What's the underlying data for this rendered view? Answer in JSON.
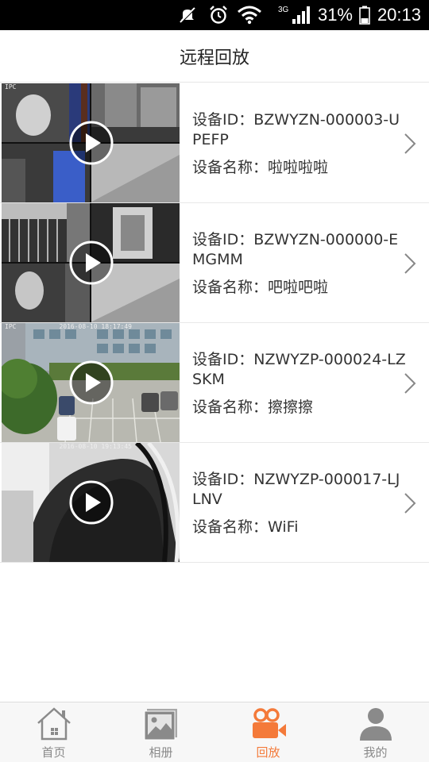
{
  "status_bar": {
    "network": "3G",
    "battery": "31%",
    "time": "20:13"
  },
  "header": {
    "title": "远程回放"
  },
  "devices": [
    {
      "id_text": "设备ID：BZWYZN-000003-UPEFP",
      "name_text": "设备名称：啦啦啦啦",
      "stamp_label": "IPC",
      "stamp_time": ""
    },
    {
      "id_text": "设备ID：BZWYZN-000000-EMGMM",
      "name_text": "设备名称：吧啦吧啦",
      "stamp_label": "",
      "stamp_time": ""
    },
    {
      "id_text": "设备ID：NZWYZP-000024-LZSKM",
      "name_text": "设备名称：擦擦擦",
      "stamp_label": "IPC",
      "stamp_time": "2016-08-10 18:17:49"
    },
    {
      "id_text": "设备ID：NZWYZP-000017-LJLNV",
      "name_text": "设备名称：WiFi",
      "stamp_label": "IPC",
      "stamp_time": "2016-08-10 19:13:45"
    }
  ],
  "tabs": [
    {
      "label": "首页",
      "icon": "home-icon",
      "active": false
    },
    {
      "label": "相册",
      "icon": "album-icon",
      "active": false
    },
    {
      "label": "回放",
      "icon": "camera-playback-icon",
      "active": true
    },
    {
      "label": "我的",
      "icon": "user-icon",
      "active": false
    }
  ],
  "colors": {
    "accent": "#f47a3a",
    "inactive": "#8a8a8a",
    "status_bar": "#000000"
  }
}
